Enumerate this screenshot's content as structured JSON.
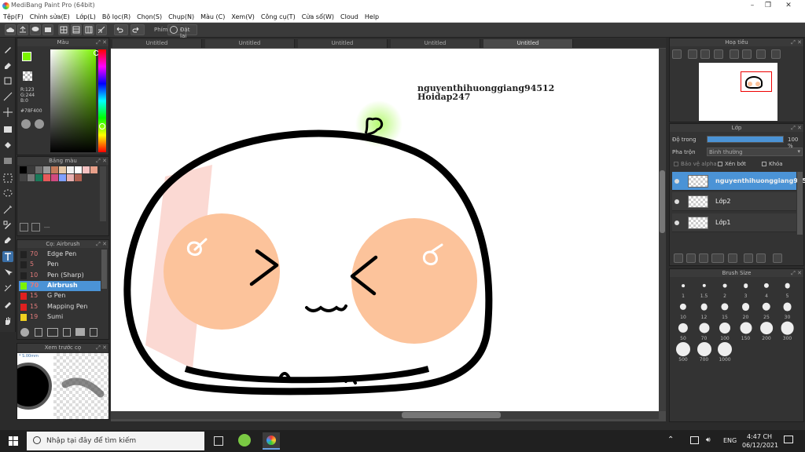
{
  "window": {
    "title": "MediBang Paint Pro (64bit)"
  },
  "menu": [
    "Tệp(F)",
    "Chỉnh sửa(E)",
    "Lớp(L)",
    "Bộ lọc(R)",
    "Chọn(S)",
    "Chụp(N)",
    "Màu (C)",
    "Xem(V)",
    "Công cụ(T)",
    "Cửa sổ(W)",
    "Cloud",
    "Help"
  ],
  "toolbar": {
    "shortcut_label": "Phím",
    "reset_label": "Đặt lại"
  },
  "tabs": [
    "Untitled",
    "Untitled",
    "Untitled",
    "Untitled",
    "Untitled"
  ],
  "color_panel": {
    "title": "Màu",
    "r": "R:123",
    "g": "G:244",
    "b": "B:0",
    "hex": "#78F400",
    "fg_color": "#7BF400",
    "bg_color": "#000000"
  },
  "palette_panel": {
    "title": "Bảng màu",
    "placeholder": "---",
    "colors": [
      "#000000",
      "#3a3a3a",
      "#6b6b6b",
      "#9a9a9a",
      "#c47b5a",
      "#e6c9a8",
      "#f0f0f0",
      "#ffffff",
      "#f5c2c2",
      "#e8a08a",
      "#444444",
      "#777777",
      "#1a7a5a",
      "#e65a5a",
      "#d04a80",
      "#7fa0ff",
      "#e8b0b0",
      "#b06050"
    ]
  },
  "brush_panel": {
    "title": "Cọ: Airbrush",
    "brushes": [
      {
        "size": "70",
        "name": "Edge Pen",
        "color": "#222222"
      },
      {
        "size": "5",
        "name": "Pen",
        "color": "#222222"
      },
      {
        "size": "10",
        "name": "Pen (Sharp)",
        "color": "#222222"
      },
      {
        "size": "70",
        "name": "Airbrush",
        "color": "#7bf400"
      },
      {
        "size": "15",
        "name": "G Pen",
        "color": "#e02020"
      },
      {
        "size": "15",
        "name": "Mapping Pen",
        "color": "#e02020"
      },
      {
        "size": "19",
        "name": "Sumi",
        "color": "#f0d020"
      }
    ]
  },
  "preview_panel": {
    "title": "Xem trước cọ",
    "label": "* S.00mm"
  },
  "navigator_panel": {
    "title": "Hoạ tiêu"
  },
  "layer_panel": {
    "title": "Lớp",
    "opacity_label": "Độ trong",
    "opacity_value": "100 %",
    "opacity_fraction": 1.0,
    "blend_label": "Pha trộn",
    "blend_value": "Bình thường",
    "protect_alpha": "Bảo vệ alpha",
    "clipping": "Xén bớt",
    "lock": "Khóa",
    "layers": [
      "nguyenthihuonggiang94512",
      "Lớp2",
      "Lớp1"
    ]
  },
  "brush_size_panel": {
    "title": "Brush Size",
    "sizes": [
      "1",
      "1.5",
      "2",
      "3",
      "4",
      "5",
      "10",
      "12",
      "15",
      "20",
      "25",
      "30",
      "50",
      "70",
      "100",
      "150",
      "200",
      "300",
      "500",
      "700",
      "1000"
    ]
  },
  "canvas": {
    "text_line1": "nguyenthihuonggiang94512",
    "text_line2": "Hoidap247"
  },
  "taskbar": {
    "search_placeholder": "Nhập tại đây để tìm kiếm",
    "lang": "ENG",
    "time": "4:47 CH",
    "date": "06/12/2021"
  }
}
